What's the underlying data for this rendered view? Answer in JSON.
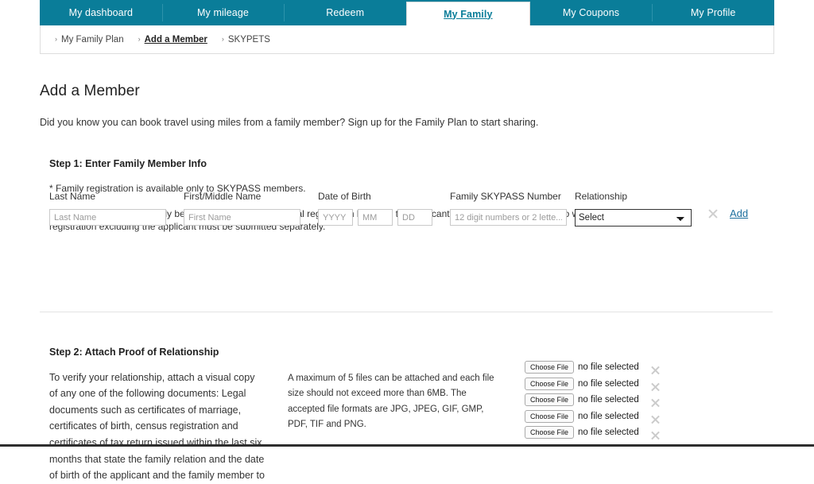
{
  "nav": {
    "tabs": [
      {
        "label": "My dashboard",
        "active": false
      },
      {
        "label": "My mileage",
        "active": false
      },
      {
        "label": "Redeem",
        "active": false
      },
      {
        "label": "My Family",
        "active": true
      },
      {
        "label": "My Coupons",
        "active": false
      },
      {
        "label": "My Profile",
        "active": false
      }
    ],
    "bar_color": "#0a7d99",
    "active_text_color": "#0a7d99"
  },
  "breadcrumb": {
    "items": [
      {
        "label": "My Family Plan",
        "current": false
      },
      {
        "label": "Add a Member",
        "current": true
      },
      {
        "label": "SKYPETS",
        "current": false
      }
    ],
    "separator": "›"
  },
  "main": {
    "title": "Add a Member",
    "intro": "Did you know you can book travel using miles from a family member? Sign up for the Family Plan to start sharing."
  },
  "step1": {
    "heading": "Step 1: Enter Family Member Info",
    "note1": "* Family registration is available only to SKYPASS members.",
    "note2": "* Family registration can only be made as one-to-one mutual registration between the applicant and the family member who wises to register. Family registration excluding the applicant must be submitted separately.",
    "fields": {
      "last_name": {
        "label": "Last Name",
        "placeholder": "Last Name",
        "value": ""
      },
      "first_name": {
        "label": "First/Middle Name",
        "placeholder": "First Name",
        "value": ""
      },
      "dob": {
        "label": "Date of Birth",
        "year": {
          "placeholder": "YYYY",
          "value": ""
        },
        "month": {
          "placeholder": "MM",
          "value": ""
        },
        "day": {
          "placeholder": "DD",
          "value": ""
        }
      },
      "skypass": {
        "label": "Family SKYPASS Number",
        "placeholder": "12 digit numbers or 2 lette...",
        "value": ""
      },
      "relationship": {
        "label": "Relationship",
        "selected": "Select",
        "options": [
          "Select"
        ]
      }
    },
    "remove_icon": "close-icon",
    "add_label": "Add",
    "add_link_color": "#1d6f9e"
  },
  "step2": {
    "heading": "Step 2: Attach Proof of Relationship",
    "body": "To verify your relationship, attach a visual copy of any one of the following documents: Legal documents such as certificates of marriage, certificates of birth, census registration and certificates of tax return issued within the last six months that state the family relation and the date of birth of the applicant and the family member to",
    "upload_note": "A maximum of 5 files can be attached and each file size should not exceed more than 6MB. The accepted file formats are JPG, JPEG, GIF, GMP, PDF, TIF and PNG.",
    "uploads": [
      {
        "button_label": "Choose File",
        "status": "no file selected"
      },
      {
        "button_label": "Choose File",
        "status": "no file selected"
      },
      {
        "button_label": "Choose File",
        "status": "no file selected"
      },
      {
        "button_label": "Choose File",
        "status": "no file selected"
      },
      {
        "button_label": "Choose File",
        "status": "no file selected"
      }
    ],
    "remove_icon": "close-icon"
  }
}
